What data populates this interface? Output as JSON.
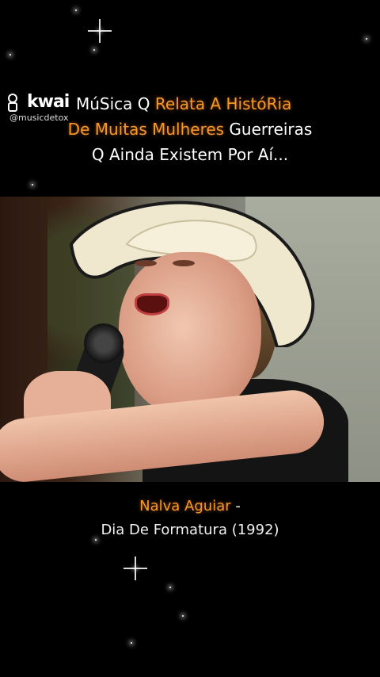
{
  "watermark": {
    "app": "kwai",
    "handle": "@musicdetox"
  },
  "caption": {
    "line1_plain": "MúSica Q ",
    "line1_highlight": "Relata A HistóRia",
    "line2_highlight": "De Muitas Mulheres",
    "line2_plain": " Guerreiras",
    "line3": "Q Ainda Existem Por Aí..."
  },
  "song": {
    "artist": "Nalva Aguiar",
    "separator": " -",
    "title": "Dia De Formatura (1992)"
  },
  "colors": {
    "highlight": "#f39a2a",
    "background": "#000000",
    "text": "#ffffff"
  },
  "icons": [
    "kwai-logo-icon",
    "sparkle-icon"
  ]
}
